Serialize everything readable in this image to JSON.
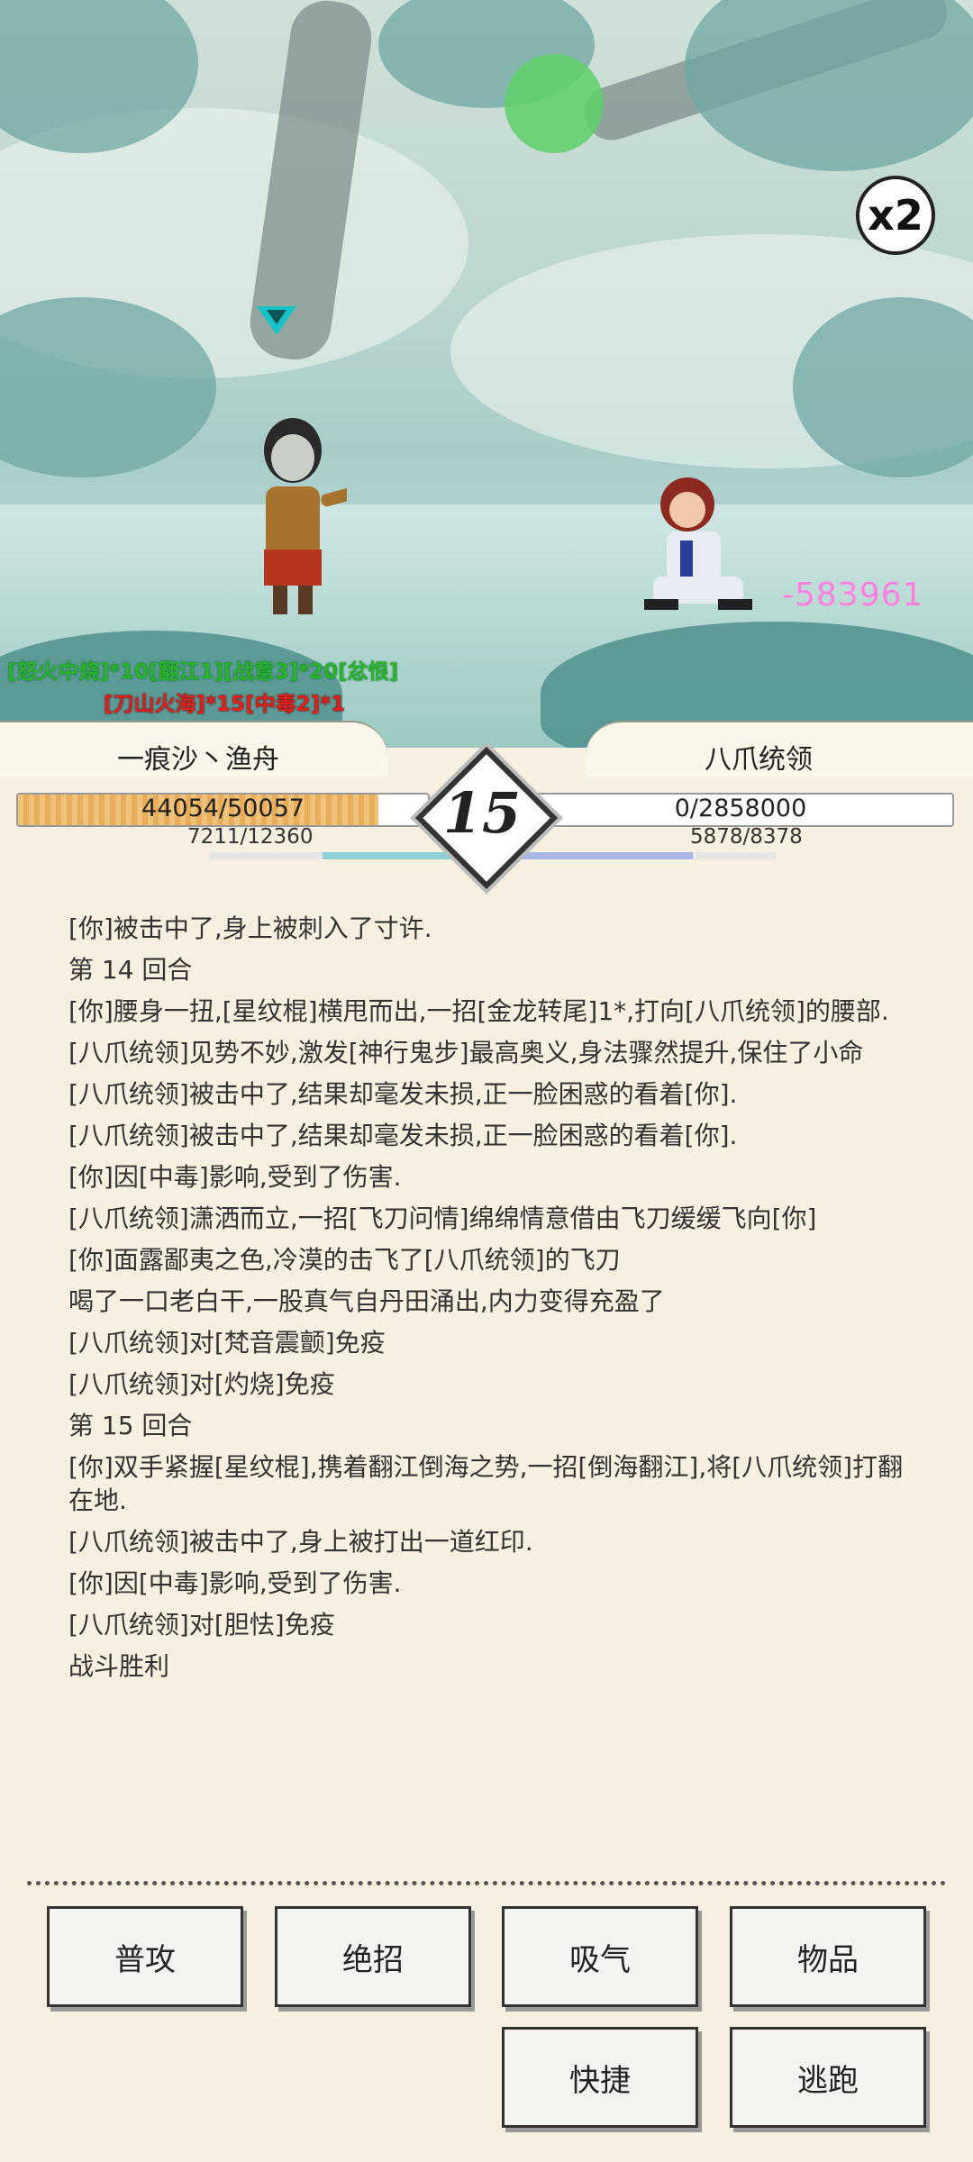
{
  "combo": "x2",
  "damage_popup": "-583961",
  "status_effects": {
    "line1": "[怒火中烧]*10[翻江1][战意3]*20[忿恨]",
    "line2": "[刀山火海]*15[中毒2]*1"
  },
  "player": {
    "name": "一痕沙丶渔舟",
    "hp": "44054/50057",
    "hp_fraction": 0.88,
    "mp": "7211/12360",
    "mp_fraction": 0.58
  },
  "enemy": {
    "name": "八爪统领",
    "hp": "0/2858000",
    "hp_fraction": 0,
    "mp": "5878/8378",
    "mp_fraction": 0.7
  },
  "turn": "15",
  "colors": {
    "hp_fill": "#f0c27a",
    "mp_player": "#8fcfd6",
    "mp_enemy": "#a9b6e6",
    "damage": "#ff7fe0",
    "status_green": "#2bb12b",
    "status_red": "#e0201c"
  },
  "log": [
    "[你]被击中了,身上被刺入了寸许.",
    "第 14 回合",
    "[你]腰身一扭,[星纹棍]横甩而出,一招[金龙转尾]1*,打向[八爪统领]的腰部.",
    "[八爪统领]见势不妙,激发[神行鬼步]最高奥义,身法骤然提升,保住了小命",
    "[八爪统领]被击中了,结果却毫发未损,正一脸困惑的看着[你].",
    "[八爪统领]被击中了,结果却毫发未损,正一脸困惑的看着[你].",
    "[你]因[中毒]影响,受到了伤害.",
    "[八爪统领]潇洒而立,一招[飞刀问情]绵绵情意借由飞刀缓缓飞向[你]",
    "[你]面露鄙夷之色,冷漠的击飞了[八爪统领]的飞刀",
    "喝了一口老白干,一股真气自丹田涌出,内力变得充盈了",
    "[八爪统领]对[梵音震颤]免疫",
    "[八爪统领]对[灼烧]免疫",
    "第 15 回合",
    "[你]双手紧握[星纹棍],携着翻江倒海之势,一招[倒海翻江],将[八爪统领]打翻在地.",
    "[八爪统领]被击中了,身上被打出一道红印.",
    "[你]因[中毒]影响,受到了伤害.",
    "[八爪统领]对[胆怯]免疫",
    "战斗胜利"
  ],
  "buttons": {
    "attack": "普攻",
    "ultimate": "绝招",
    "breathe": "吸气",
    "items": "物品",
    "quick": "快捷",
    "flee": "逃跑"
  }
}
